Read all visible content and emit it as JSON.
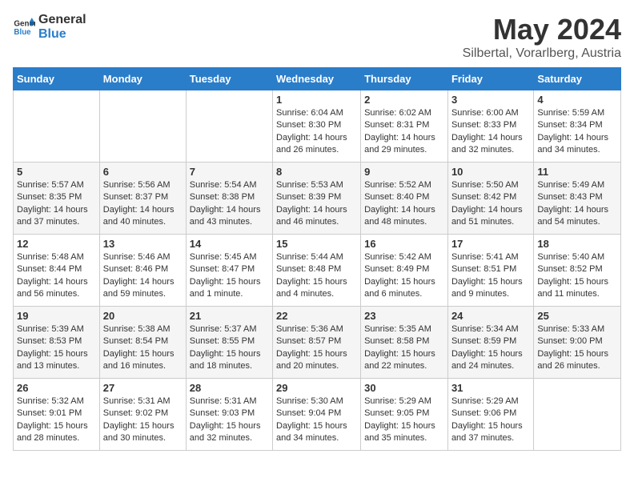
{
  "header": {
    "logo_line1": "General",
    "logo_line2": "Blue",
    "title": "May 2024",
    "subtitle": "Silbertal, Vorarlberg, Austria"
  },
  "days_of_week": [
    "Sunday",
    "Monday",
    "Tuesday",
    "Wednesday",
    "Thursday",
    "Friday",
    "Saturday"
  ],
  "weeks": [
    [
      {
        "day": "",
        "sunrise": "",
        "sunset": "",
        "daylight": ""
      },
      {
        "day": "",
        "sunrise": "",
        "sunset": "",
        "daylight": ""
      },
      {
        "day": "",
        "sunrise": "",
        "sunset": "",
        "daylight": ""
      },
      {
        "day": "1",
        "sunrise": "6:04 AM",
        "sunset": "8:30 PM",
        "daylight": "14 hours and 26 minutes."
      },
      {
        "day": "2",
        "sunrise": "6:02 AM",
        "sunset": "8:31 PM",
        "daylight": "14 hours and 29 minutes."
      },
      {
        "day": "3",
        "sunrise": "6:00 AM",
        "sunset": "8:33 PM",
        "daylight": "14 hours and 32 minutes."
      },
      {
        "day": "4",
        "sunrise": "5:59 AM",
        "sunset": "8:34 PM",
        "daylight": "14 hours and 34 minutes."
      }
    ],
    [
      {
        "day": "5",
        "sunrise": "5:57 AM",
        "sunset": "8:35 PM",
        "daylight": "14 hours and 37 minutes."
      },
      {
        "day": "6",
        "sunrise": "5:56 AM",
        "sunset": "8:37 PM",
        "daylight": "14 hours and 40 minutes."
      },
      {
        "day": "7",
        "sunrise": "5:54 AM",
        "sunset": "8:38 PM",
        "daylight": "14 hours and 43 minutes."
      },
      {
        "day": "8",
        "sunrise": "5:53 AM",
        "sunset": "8:39 PM",
        "daylight": "14 hours and 46 minutes."
      },
      {
        "day": "9",
        "sunrise": "5:52 AM",
        "sunset": "8:40 PM",
        "daylight": "14 hours and 48 minutes."
      },
      {
        "day": "10",
        "sunrise": "5:50 AM",
        "sunset": "8:42 PM",
        "daylight": "14 hours and 51 minutes."
      },
      {
        "day": "11",
        "sunrise": "5:49 AM",
        "sunset": "8:43 PM",
        "daylight": "14 hours and 54 minutes."
      }
    ],
    [
      {
        "day": "12",
        "sunrise": "5:48 AM",
        "sunset": "8:44 PM",
        "daylight": "14 hours and 56 minutes."
      },
      {
        "day": "13",
        "sunrise": "5:46 AM",
        "sunset": "8:46 PM",
        "daylight": "14 hours and 59 minutes."
      },
      {
        "day": "14",
        "sunrise": "5:45 AM",
        "sunset": "8:47 PM",
        "daylight": "15 hours and 1 minute."
      },
      {
        "day": "15",
        "sunrise": "5:44 AM",
        "sunset": "8:48 PM",
        "daylight": "15 hours and 4 minutes."
      },
      {
        "day": "16",
        "sunrise": "5:42 AM",
        "sunset": "8:49 PM",
        "daylight": "15 hours and 6 minutes."
      },
      {
        "day": "17",
        "sunrise": "5:41 AM",
        "sunset": "8:51 PM",
        "daylight": "15 hours and 9 minutes."
      },
      {
        "day": "18",
        "sunrise": "5:40 AM",
        "sunset": "8:52 PM",
        "daylight": "15 hours and 11 minutes."
      }
    ],
    [
      {
        "day": "19",
        "sunrise": "5:39 AM",
        "sunset": "8:53 PM",
        "daylight": "15 hours and 13 minutes."
      },
      {
        "day": "20",
        "sunrise": "5:38 AM",
        "sunset": "8:54 PM",
        "daylight": "15 hours and 16 minutes."
      },
      {
        "day": "21",
        "sunrise": "5:37 AM",
        "sunset": "8:55 PM",
        "daylight": "15 hours and 18 minutes."
      },
      {
        "day": "22",
        "sunrise": "5:36 AM",
        "sunset": "8:57 PM",
        "daylight": "15 hours and 20 minutes."
      },
      {
        "day": "23",
        "sunrise": "5:35 AM",
        "sunset": "8:58 PM",
        "daylight": "15 hours and 22 minutes."
      },
      {
        "day": "24",
        "sunrise": "5:34 AM",
        "sunset": "8:59 PM",
        "daylight": "15 hours and 24 minutes."
      },
      {
        "day": "25",
        "sunrise": "5:33 AM",
        "sunset": "9:00 PM",
        "daylight": "15 hours and 26 minutes."
      }
    ],
    [
      {
        "day": "26",
        "sunrise": "5:32 AM",
        "sunset": "9:01 PM",
        "daylight": "15 hours and 28 minutes."
      },
      {
        "day": "27",
        "sunrise": "5:31 AM",
        "sunset": "9:02 PM",
        "daylight": "15 hours and 30 minutes."
      },
      {
        "day": "28",
        "sunrise": "5:31 AM",
        "sunset": "9:03 PM",
        "daylight": "15 hours and 32 minutes."
      },
      {
        "day": "29",
        "sunrise": "5:30 AM",
        "sunset": "9:04 PM",
        "daylight": "15 hours and 34 minutes."
      },
      {
        "day": "30",
        "sunrise": "5:29 AM",
        "sunset": "9:05 PM",
        "daylight": "15 hours and 35 minutes."
      },
      {
        "day": "31",
        "sunrise": "5:29 AM",
        "sunset": "9:06 PM",
        "daylight": "15 hours and 37 minutes."
      },
      {
        "day": "",
        "sunrise": "",
        "sunset": "",
        "daylight": ""
      }
    ]
  ]
}
